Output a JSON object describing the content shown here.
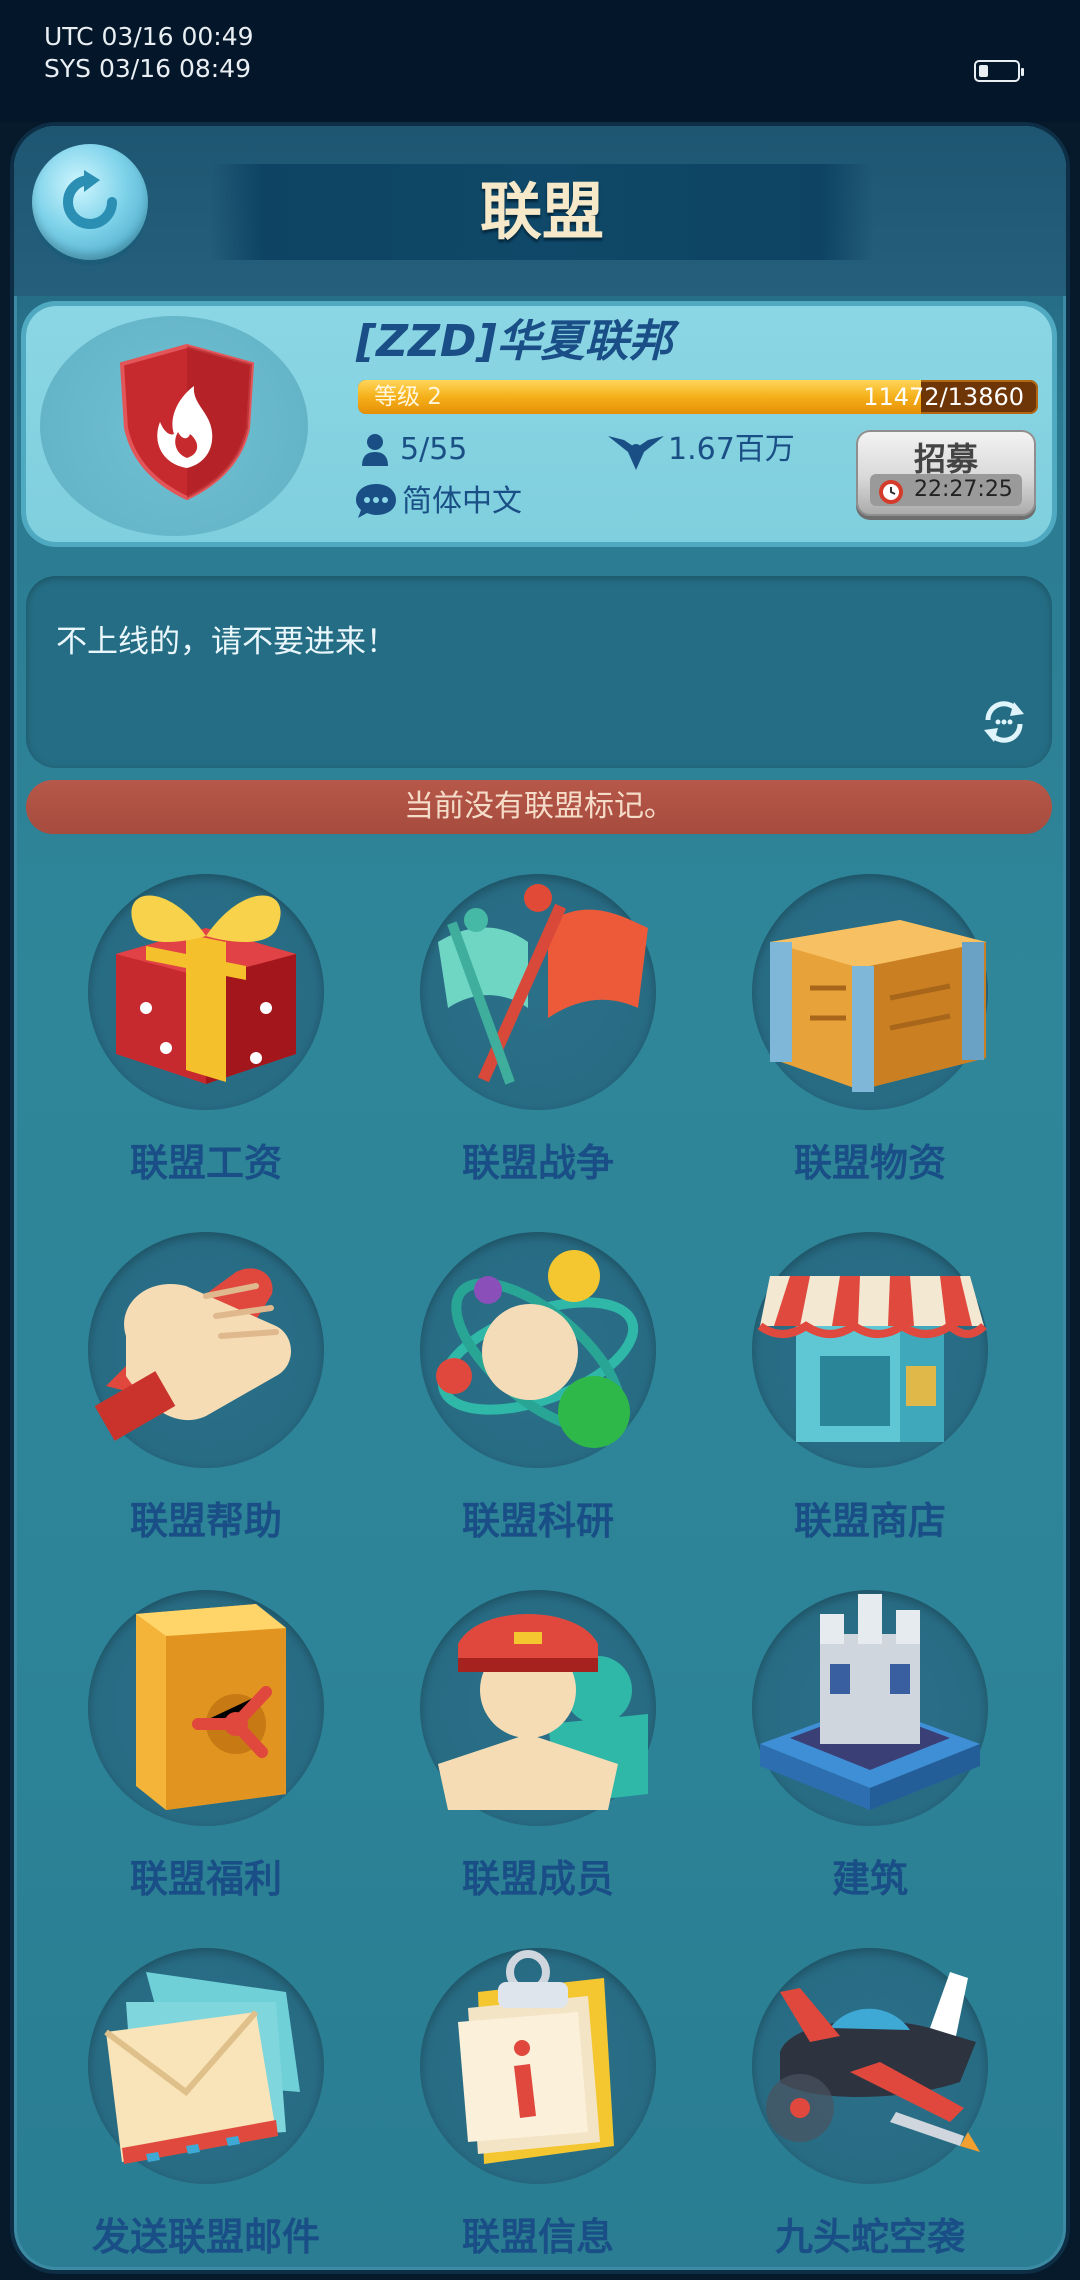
{
  "status_bar": {
    "utc_time": "UTC 03/16 00:49",
    "sys_time": "SYS 03/16 08:49",
    "battery_level": 0.25
  },
  "header": {
    "title": "联盟",
    "back_icon": "back-arrow-icon"
  },
  "alliance": {
    "tag": "[ZZD]",
    "name": "华夏联邦",
    "level_label": "等级 2",
    "level_progress_text": "11472/13860",
    "level_progress_current": 11472,
    "level_progress_max": 13860,
    "members": "5/55",
    "power": "1.67百万",
    "language": "简体中文",
    "recruit": {
      "label": "招募",
      "timer": "22:27:25"
    }
  },
  "announcement": {
    "text": "不上线的，请不要进来！"
  },
  "banner": {
    "text": "当前没有联盟标记。"
  },
  "menu": [
    {
      "label": "联盟工资",
      "icon": "gift-box-icon"
    },
    {
      "label": "联盟战争",
      "icon": "war-flags-icon"
    },
    {
      "label": "联盟物资",
      "icon": "supply-crate-icon"
    },
    {
      "label": "联盟帮助",
      "icon": "handshake-icon"
    },
    {
      "label": "联盟科研",
      "icon": "atom-icon"
    },
    {
      "label": "联盟商店",
      "icon": "shop-icon"
    },
    {
      "label": "联盟福利",
      "icon": "safe-icon"
    },
    {
      "label": "联盟成员",
      "icon": "members-icon"
    },
    {
      "label": "建筑",
      "icon": "fortress-icon"
    },
    {
      "label": "发送联盟邮件",
      "icon": "mail-icon"
    },
    {
      "label": "联盟信息",
      "icon": "info-clipboard-icon"
    },
    {
      "label": "九头蛇空袭",
      "icon": "air-raid-plane-icon"
    }
  ],
  "colors": {
    "label": "#194f86",
    "banner": "#a64b3e",
    "title": "#f6e9c9"
  }
}
